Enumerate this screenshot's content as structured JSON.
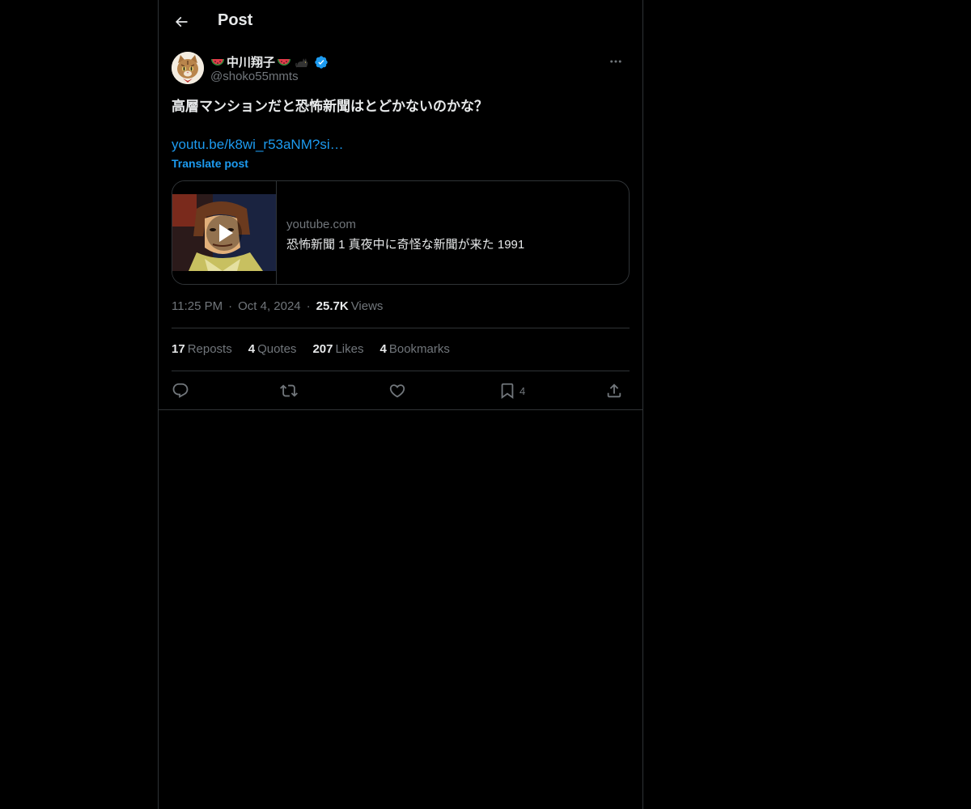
{
  "header": {
    "title": "Post",
    "back_icon": "arrow-left-icon"
  },
  "author": {
    "display_name": "中川翔子",
    "name_emoji_left": "watermelon",
    "name_emoji_right": "watermelon",
    "name_emoji_extra": "black-cat",
    "verified": true,
    "handle": "@shoko55mmts",
    "avatar_icon": "cat-face-avatar"
  },
  "post": {
    "text": "高層マンションだと恐怖新聞はとどかないのかな？",
    "link": "youtu.be/k8wi_r53aNM?si…",
    "translate_label": "Translate post"
  },
  "card": {
    "domain": "youtube.com",
    "title": "恐怖新聞 1 真夜中に奇怪な新聞が来た 1991",
    "play_icon": "play-icon"
  },
  "meta": {
    "time": "11:25 PM",
    "date": "Oct 4, 2024",
    "views_count": "25.7K",
    "views_label": "Views"
  },
  "stats": {
    "reposts_count": "17",
    "reposts_label": "Reposts",
    "quotes_count": "4",
    "quotes_label": "Quotes",
    "likes_count": "207",
    "likes_label": "Likes",
    "bookmarks_count": "4",
    "bookmarks_label": "Bookmarks"
  },
  "actions": {
    "bookmark_count": "4"
  },
  "colors": {
    "background": "#000000",
    "accent": "#1d9bf0",
    "text_primary": "#e7e9ea",
    "text_secondary": "#71767b",
    "border": "#2f3336"
  }
}
